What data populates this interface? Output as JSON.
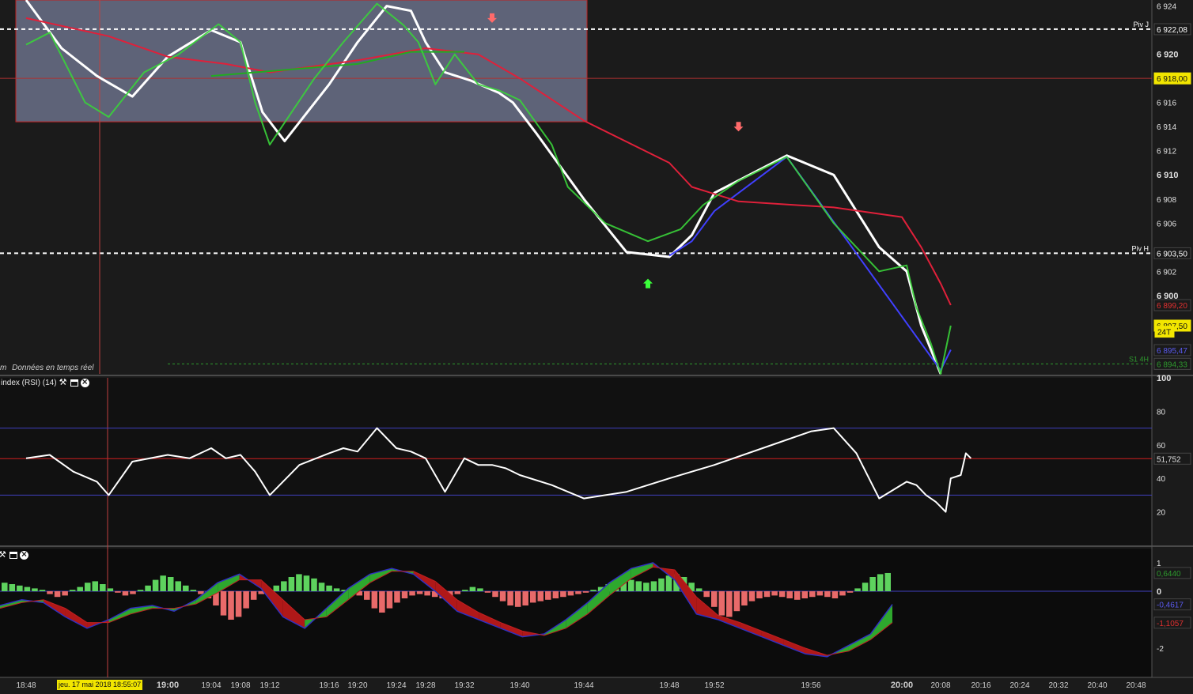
{
  "chart_data": {
    "type": "line",
    "time_axis": {
      "ticks": [
        "18:48",
        "19:00",
        "19:04",
        "19:08",
        "19:12",
        "19:16",
        "19:20",
        "19:24",
        "19:28",
        "19:32",
        "19:40",
        "19:44",
        "19:48",
        "19:52",
        "19:56",
        "20:00",
        "20:08",
        "20:16",
        "20:24",
        "20:32",
        "20:40",
        "20:48"
      ],
      "crosshair_label": "jeu. 17 mai 2018 18:55:07"
    },
    "price_panel": {
      "ylim": [
        6893.5,
        6924.5
      ],
      "ticks": [
        "6 924",
        "6 920",
        "6 916",
        "6 914",
        "6 912",
        "6 910",
        "6 908",
        "6 906",
        "6 902",
        "6 900"
      ],
      "bold_ticks": [
        "6 920",
        "6 910",
        "6 900"
      ],
      "subtitle": "Données en temps réel",
      "subtitle_prefix": "m",
      "highlight_zone": {
        "x0": "18:48",
        "x1": "19:32",
        "price_low": 6914.4,
        "price_high": 6924.5,
        "color": "#6a7088"
      },
      "levels": [
        {
          "name": "Piv J",
          "value": 6922.08,
          "label": "6 922,08",
          "style": "dashed",
          "color": "#ffffff"
        },
        {
          "name": "Piv H",
          "value": 6903.5,
          "label": "6 903,50",
          "style": "dashed",
          "color": "#ffffff"
        },
        {
          "name": "S1 4H",
          "value": 6894.33,
          "label": "6 894,33",
          "style": "dotted",
          "color": "#2e9a2e"
        },
        {
          "name": "",
          "value": 6918.0,
          "label": "6 918,00",
          "style": "thin",
          "color": "#b03030"
        }
      ],
      "badges": [
        {
          "label": "6 918,00",
          "bg": "#f2e600",
          "fg": "#111111"
        },
        {
          "label": "6 899,20",
          "bg": "#1a1a1a",
          "fg": "#e03030"
        },
        {
          "label": "6 897,50",
          "bg": "#f2e600",
          "fg": "#111111"
        },
        {
          "label": "24T",
          "bg": "#f2e600",
          "fg": "#111111"
        },
        {
          "label": "6 895,47",
          "bg": "#1a1a1a",
          "fg": "#5a5af0"
        },
        {
          "label": "6 894,33",
          "bg": "#1a1a1a",
          "fg": "#2e9a2e"
        }
      ],
      "series": [
        {
          "name": "",
          "color": "#ffffff",
          "points": [
            [
              "18:48",
              6924.5
            ],
            [
              "18:51",
              6920.5
            ],
            [
              "18:54",
              6918.2
            ],
            [
              "18:57",
              6916.5
            ],
            [
              "19:00",
              6919.8
            ],
            [
              "19:04",
              6922.0
            ],
            [
              "19:08",
              6921.0
            ],
            [
              "19:11",
              6915.2
            ],
            [
              "19:13",
              6912.8
            ],
            [
              "19:16",
              6917.5
            ],
            [
              "19:20",
              6921.0
            ],
            [
              "19:23",
              6924.0
            ],
            [
              "19:26",
              6923.6
            ],
            [
              "19:28",
              6921.0
            ],
            [
              "19:30",
              6918.5
            ],
            [
              "19:33",
              6917.8
            ],
            [
              "19:37",
              6916.8
            ],
            [
              "19:39",
              6916.0
            ],
            [
              "19:41",
              6913.5
            ],
            [
              "19:44",
              6908.0
            ],
            [
              "19:46",
              6903.6
            ],
            [
              "19:48",
              6903.2
            ],
            [
              "19:50",
              6905.0
            ],
            [
              "19:52",
              6908.5
            ],
            [
              "19:55",
              6911.6
            ],
            [
              "19:57",
              6910.0
            ],
            [
              "19:59",
              6904.0
            ],
            [
              "20:01",
              6902.0
            ],
            [
              "20:04",
              6897.5
            ],
            [
              "20:06",
              6895.5
            ],
            [
              "20:08",
              6893.5
            ]
          ]
        },
        {
          "name": "",
          "color": "#4040ff",
          "points": [
            [
              "19:48",
              6903.3
            ],
            [
              "19:50",
              6904.5
            ],
            [
              "19:52",
              6907.0
            ],
            [
              "19:55",
              6911.5
            ],
            [
              "20:08",
              6893.8
            ],
            [
              "20:10",
              6895.5
            ]
          ]
        },
        {
          "name": "",
          "color": "#e0203a",
          "points": [
            [
              "18:48",
              6923.0
            ],
            [
              "18:55",
              6921.5
            ],
            [
              "19:00",
              6919.8
            ],
            [
              "19:06",
              6919.2
            ],
            [
              "19:12",
              6918.5
            ],
            [
              "19:20",
              6919.5
            ],
            [
              "19:28",
              6920.5
            ],
            [
              "19:34",
              6920.0
            ],
            [
              "19:40",
              6918.0
            ],
            [
              "19:44",
              6914.5
            ],
            [
              "19:48",
              6911.0
            ],
            [
              "19:50",
              6909.0
            ],
            [
              "19:53",
              6907.8
            ],
            [
              "19:57",
              6907.3
            ],
            [
              "20:00",
              6906.5
            ],
            [
              "20:04",
              6904.0
            ],
            [
              "20:08",
              6901.0
            ],
            [
              "20:10",
              6899.2
            ]
          ]
        },
        {
          "name": "",
          "color": "#22aa22",
          "points": [
            [
              "19:04",
              6918.2
            ],
            [
              "19:12",
              6918.6
            ],
            [
              "19:20",
              6919.2
            ],
            [
              "19:26",
              6920.2
            ],
            [
              "19:32",
              6920.2
            ]
          ]
        },
        {
          "name": "",
          "color": "#3ad33a",
          "points": [
            [
              "18:48",
              6920.8
            ],
            [
              "18:50",
              6921.8
            ],
            [
              "18:53",
              6916.0
            ],
            [
              "18:55",
              6914.8
            ],
            [
              "18:58",
              6918.5
            ],
            [
              "19:01",
              6920.0
            ],
            [
              "19:05",
              6922.5
            ],
            [
              "19:08",
              6921.0
            ],
            [
              "19:10",
              6916.0
            ],
            [
              "19:12",
              6912.5
            ],
            [
              "19:15",
              6918.0
            ],
            [
              "19:18",
              6921.0
            ],
            [
              "19:22",
              6924.2
            ],
            [
              "19:25",
              6922.4
            ],
            [
              "19:27",
              6921.0
            ],
            [
              "19:29",
              6917.5
            ],
            [
              "19:31",
              6920.0
            ],
            [
              "19:34",
              6917.5
            ],
            [
              "19:37",
              6917.0
            ],
            [
              "19:40",
              6916.2
            ],
            [
              "19:42",
              6912.5
            ],
            [
              "19:43",
              6909.0
            ],
            [
              "19:45",
              6906.0
            ],
            [
              "19:47",
              6904.5
            ],
            [
              "19:49",
              6905.5
            ],
            [
              "19:51",
              6907.5
            ],
            [
              "19:53",
              6909.5
            ],
            [
              "19:55",
              6911.5
            ],
            [
              "19:57",
              6906.0
            ],
            [
              "19:59",
              6902.0
            ],
            [
              "20:01",
              6902.5
            ],
            [
              "20:03",
              6899.0
            ],
            [
              "20:06",
              6896.0
            ],
            [
              "20:08",
              6893.5
            ],
            [
              "20:10",
              6897.5
            ]
          ]
        }
      ],
      "signals": [
        {
          "time": "19:36",
          "price": 6923.0,
          "dir": "down"
        },
        {
          "time": "19:53",
          "price": 6914.0,
          "dir": "down"
        },
        {
          "time": "19:47",
          "price": 6901.0,
          "dir": "up"
        }
      ]
    },
    "rsi_panel": {
      "title": "index (RSI) (14)",
      "ylim": [
        0,
        100
      ],
      "ticks": [
        "100",
        "80",
        "60",
        "40",
        "20"
      ],
      "levels": [
        {
          "value": 70,
          "color": "#4040c0"
        },
        {
          "value": 51.752,
          "label": "51,752",
          "color": "#d02020"
        },
        {
          "value": 30,
          "color": "#4040c0"
        }
      ],
      "series": [
        {
          "name": "",
          "color": "#ffffff",
          "points": [
            [
              "18:48",
              52
            ],
            [
              "18:50",
              54
            ],
            [
              "18:52",
              44
            ],
            [
              "18:54",
              38
            ],
            [
              "18:55",
              30
            ],
            [
              "18:57",
              50
            ],
            [
              "19:00",
              54
            ],
            [
              "19:02",
              52
            ],
            [
              "19:04",
              58
            ],
            [
              "19:06",
              52
            ],
            [
              "19:08",
              54
            ],
            [
              "19:10",
              44
            ],
            [
              "19:12",
              30
            ],
            [
              "19:14",
              48
            ],
            [
              "19:16",
              55
            ],
            [
              "19:18",
              58
            ],
            [
              "19:20",
              56
            ],
            [
              "19:22",
              70
            ],
            [
              "19:24",
              58
            ],
            [
              "19:26",
              56
            ],
            [
              "19:28",
              52
            ],
            [
              "19:30",
              32
            ],
            [
              "19:32",
              52
            ],
            [
              "19:34",
              48
            ],
            [
              "19:36",
              48
            ],
            [
              "19:38",
              46
            ],
            [
              "19:40",
              42
            ],
            [
              "19:42",
              36
            ],
            [
              "19:44",
              28
            ],
            [
              "19:46",
              32
            ],
            [
              "19:48",
              40
            ],
            [
              "19:50",
              44
            ],
            [
              "19:52",
              48
            ],
            [
              "19:54",
              58
            ],
            [
              "19:56",
              68
            ],
            [
              "19:57",
              70
            ],
            [
              "19:58",
              55
            ],
            [
              "19:59",
              28
            ],
            [
              "20:01",
              38
            ],
            [
              "20:03",
              36
            ],
            [
              "20:05",
              30
            ],
            [
              "20:07",
              26
            ],
            [
              "20:09",
              20
            ],
            [
              "20:10",
              40
            ],
            [
              "20:12",
              42
            ],
            [
              "20:13",
              55
            ],
            [
              "20:14",
              52
            ]
          ]
        }
      ]
    },
    "macd_panel": {
      "ylim": [
        -3.0,
        1.5
      ],
      "ticks": [
        "1",
        "0",
        "-2"
      ],
      "badges": [
        {
          "label": "0,6440",
          "bg": "#1a1a1a",
          "fg": "#2e9a2e"
        },
        {
          "label": "-0,4617",
          "bg": "#1a1a1a",
          "fg": "#5a5af0"
        },
        {
          "label": "-1,1057",
          "bg": "#1a1a1a",
          "fg": "#e03030"
        }
      ],
      "histogram": [
        0.3,
        0.25,
        0.2,
        0.15,
        0.1,
        0.05,
        -0.1,
        -0.2,
        -0.15,
        0.05,
        0.15,
        0.3,
        0.35,
        0.25,
        0.1,
        -0.05,
        -0.15,
        -0.1,
        0.05,
        0.2,
        0.4,
        0.55,
        0.5,
        0.35,
        0.2,
        0.05,
        -0.1,
        -0.25,
        -0.5,
        -0.85,
        -1.0,
        -0.9,
        -0.6,
        -0.3,
        -0.1,
        0.05,
        0.2,
        0.35,
        0.5,
        0.6,
        0.55,
        0.45,
        0.3,
        0.2,
        0.1,
        0.05,
        -0.05,
        -0.15,
        -0.3,
        -0.6,
        -0.75,
        -0.6,
        -0.4,
        -0.25,
        -0.15,
        -0.1,
        -0.15,
        -0.2,
        -0.25,
        -0.2,
        -0.1,
        0.05,
        0.15,
        0.1,
        -0.05,
        -0.2,
        -0.35,
        -0.5,
        -0.55,
        -0.5,
        -0.4,
        -0.35,
        -0.3,
        -0.25,
        -0.2,
        -0.15,
        -0.1,
        -0.05,
        0.05,
        0.15,
        0.25,
        0.3,
        0.35,
        0.4,
        0.35,
        0.3,
        0.35,
        0.45,
        0.55,
        0.6,
        0.5,
        0.3,
        0.1,
        -0.2,
        -0.55,
        -0.85,
        -0.9,
        -0.7,
        -0.5,
        -0.35,
        -0.25,
        -0.2,
        -0.15,
        -0.2,
        -0.25,
        -0.3,
        -0.25,
        -0.2,
        -0.15,
        -0.2,
        -0.25,
        -0.15,
        -0.05,
        0.1,
        0.3,
        0.5,
        0.6,
        0.64
      ],
      "macd": [
        -0.5,
        -0.3,
        -0.4,
        -0.9,
        -1.3,
        -1.0,
        -0.6,
        -0.5,
        -0.7,
        -0.3,
        0.3,
        0.6,
        0.1,
        -0.9,
        -1.3,
        -0.6,
        0.1,
        0.6,
        0.8,
        0.6,
        0.0,
        -0.7,
        -1.0,
        -1.3,
        -1.6,
        -1.5,
        -1.0,
        -0.4,
        0.3,
        0.8,
        1.0,
        0.4,
        -0.8,
        -1.0,
        -1.3,
        -1.6,
        -1.9,
        -2.2,
        -2.3,
        -1.9,
        -1.5,
        -0.46
      ],
      "signal": [
        -0.6,
        -0.4,
        -0.3,
        -0.6,
        -1.1,
        -1.1,
        -0.8,
        -0.6,
        -0.6,
        -0.45,
        -0.05,
        0.4,
        0.4,
        -0.3,
        -1.0,
        -0.9,
        -0.3,
        0.3,
        0.7,
        0.7,
        0.35,
        -0.3,
        -0.75,
        -1.1,
        -1.4,
        -1.55,
        -1.3,
        -0.8,
        -0.15,
        0.45,
        0.85,
        0.75,
        -0.2,
        -0.85,
        -1.1,
        -1.4,
        -1.7,
        -2.0,
        -2.25,
        -2.1,
        -1.7,
        -1.1
      ]
    }
  }
}
